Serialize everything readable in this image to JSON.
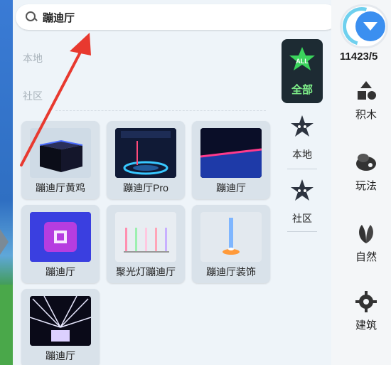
{
  "search": {
    "query": "蹦迪厅"
  },
  "sections": {
    "local": "本地",
    "community": "社区"
  },
  "results": [
    {
      "label": "蹦迪厅黄鸡",
      "thumb": "dark-cube"
    },
    {
      "label": "蹦迪厅Pro",
      "thumb": "stage-ring"
    },
    {
      "label": "蹦迪厅",
      "thumb": "neon-room"
    },
    {
      "label": "蹦迪厅",
      "thumb": "glow-cube"
    },
    {
      "label": "聚光灯蹦迪厅",
      "thumb": "spotlight-bars"
    },
    {
      "label": "蹦迪厅装饰",
      "thumb": "light-beam"
    },
    {
      "label": "蹦迪厅",
      "thumb": "laser-show"
    }
  ],
  "categories": [
    {
      "label": "全部",
      "badge": "ALL",
      "selected": true
    },
    {
      "label": "本地"
    },
    {
      "label": "社区"
    }
  ],
  "sidebar": {
    "count": "11423/5",
    "items": [
      {
        "label": "积木",
        "icon": "blocks-icon"
      },
      {
        "label": "玩法",
        "icon": "gameplay-icon"
      },
      {
        "label": "自然",
        "icon": "leaf-icon"
      },
      {
        "label": "建筑",
        "icon": "gear-icon"
      }
    ]
  },
  "colors": {
    "accent_blue": "#3b8ff0",
    "all_green": "#7ff08a",
    "annotation_red": "#e8392f"
  }
}
